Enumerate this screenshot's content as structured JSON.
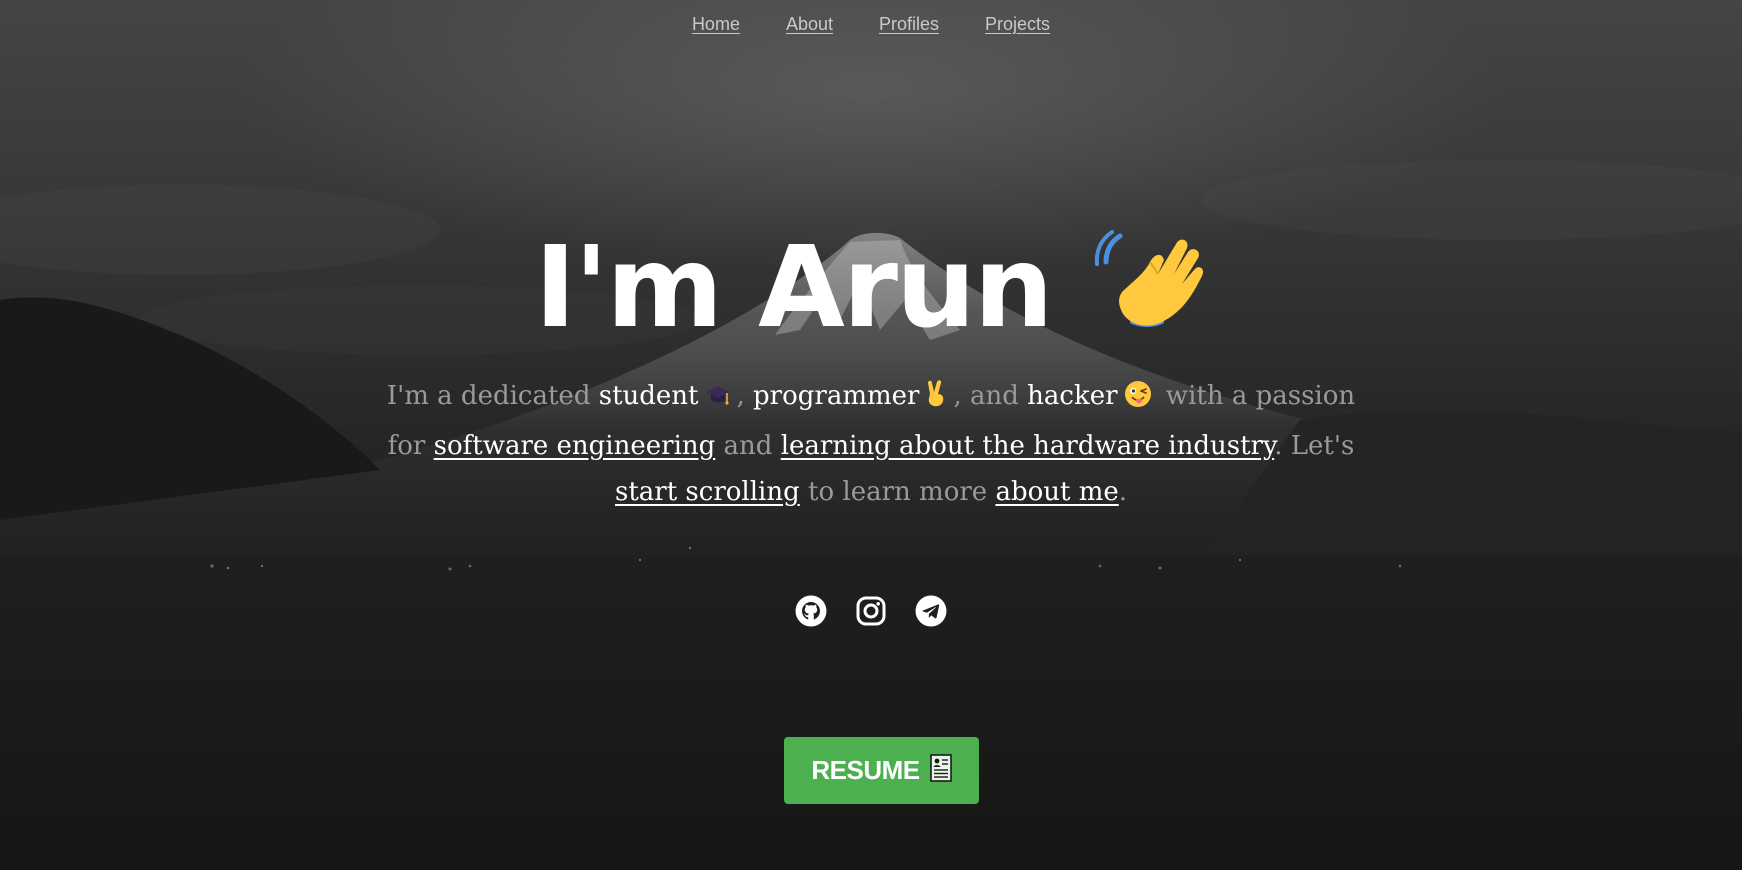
{
  "nav": {
    "items": [
      "Home",
      "About",
      "Profiles",
      "Projects"
    ]
  },
  "hero": {
    "title": "I'm Arun",
    "title_icon": "waving-hand-icon"
  },
  "intro": {
    "p1": "I'm a dedicated ",
    "w_student": "student",
    "p2": ", ",
    "w_programmer": "programmer",
    "p3": ", and ",
    "w_hacker": "hacker",
    "p4": " with a passion for ",
    "link_software": "software engineering",
    "p5": " and ",
    "link_hardware": "learning about the hardware industry",
    "p6": ". Let's ",
    "link_scroll": "start scrolling",
    "p7": " to learn more ",
    "link_about": "about me",
    "p8": "."
  },
  "socials": [
    "github-icon",
    "instagram-icon",
    "telegram-icon"
  ],
  "resume": {
    "label": "RESUME",
    "icon": "resume-document-icon"
  },
  "colors": {
    "button": "#4caf50",
    "text_muted": "#9a9a9a",
    "text_highlight": "#ffffff"
  }
}
